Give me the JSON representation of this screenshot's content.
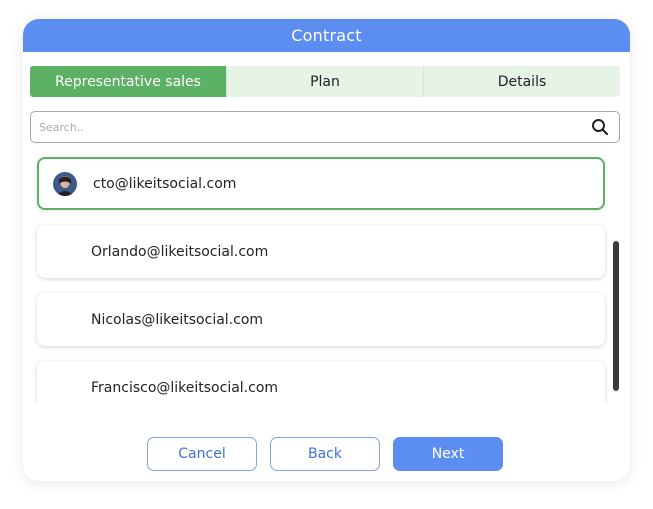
{
  "modal": {
    "title": "Contract"
  },
  "tabs": [
    {
      "label": "Representative sales",
      "active": true
    },
    {
      "label": "Plan",
      "active": false
    },
    {
      "label": "Details",
      "active": false
    }
  ],
  "search": {
    "placeholder": "Search..",
    "value": "",
    "icon": "search-icon"
  },
  "users": [
    {
      "email": "cto@likeitsocial.com",
      "selected": true,
      "has_avatar": true
    },
    {
      "email": "Orlando@likeitsocial.com",
      "selected": false,
      "has_avatar": false
    },
    {
      "email": "Nicolas@likeitsocial.com",
      "selected": false,
      "has_avatar": false
    },
    {
      "email": "Francisco@likeitsocial.com",
      "selected": false,
      "has_avatar": false
    }
  ],
  "buttons": {
    "cancel": "Cancel",
    "back": "Back",
    "next": "Next"
  },
  "colors": {
    "header": "#5b8ef0",
    "tab_active": "#5cb165",
    "tab_inactive": "#e6f4e6",
    "selected_border": "#5cb165",
    "primary_button": "#5b8ef0"
  }
}
